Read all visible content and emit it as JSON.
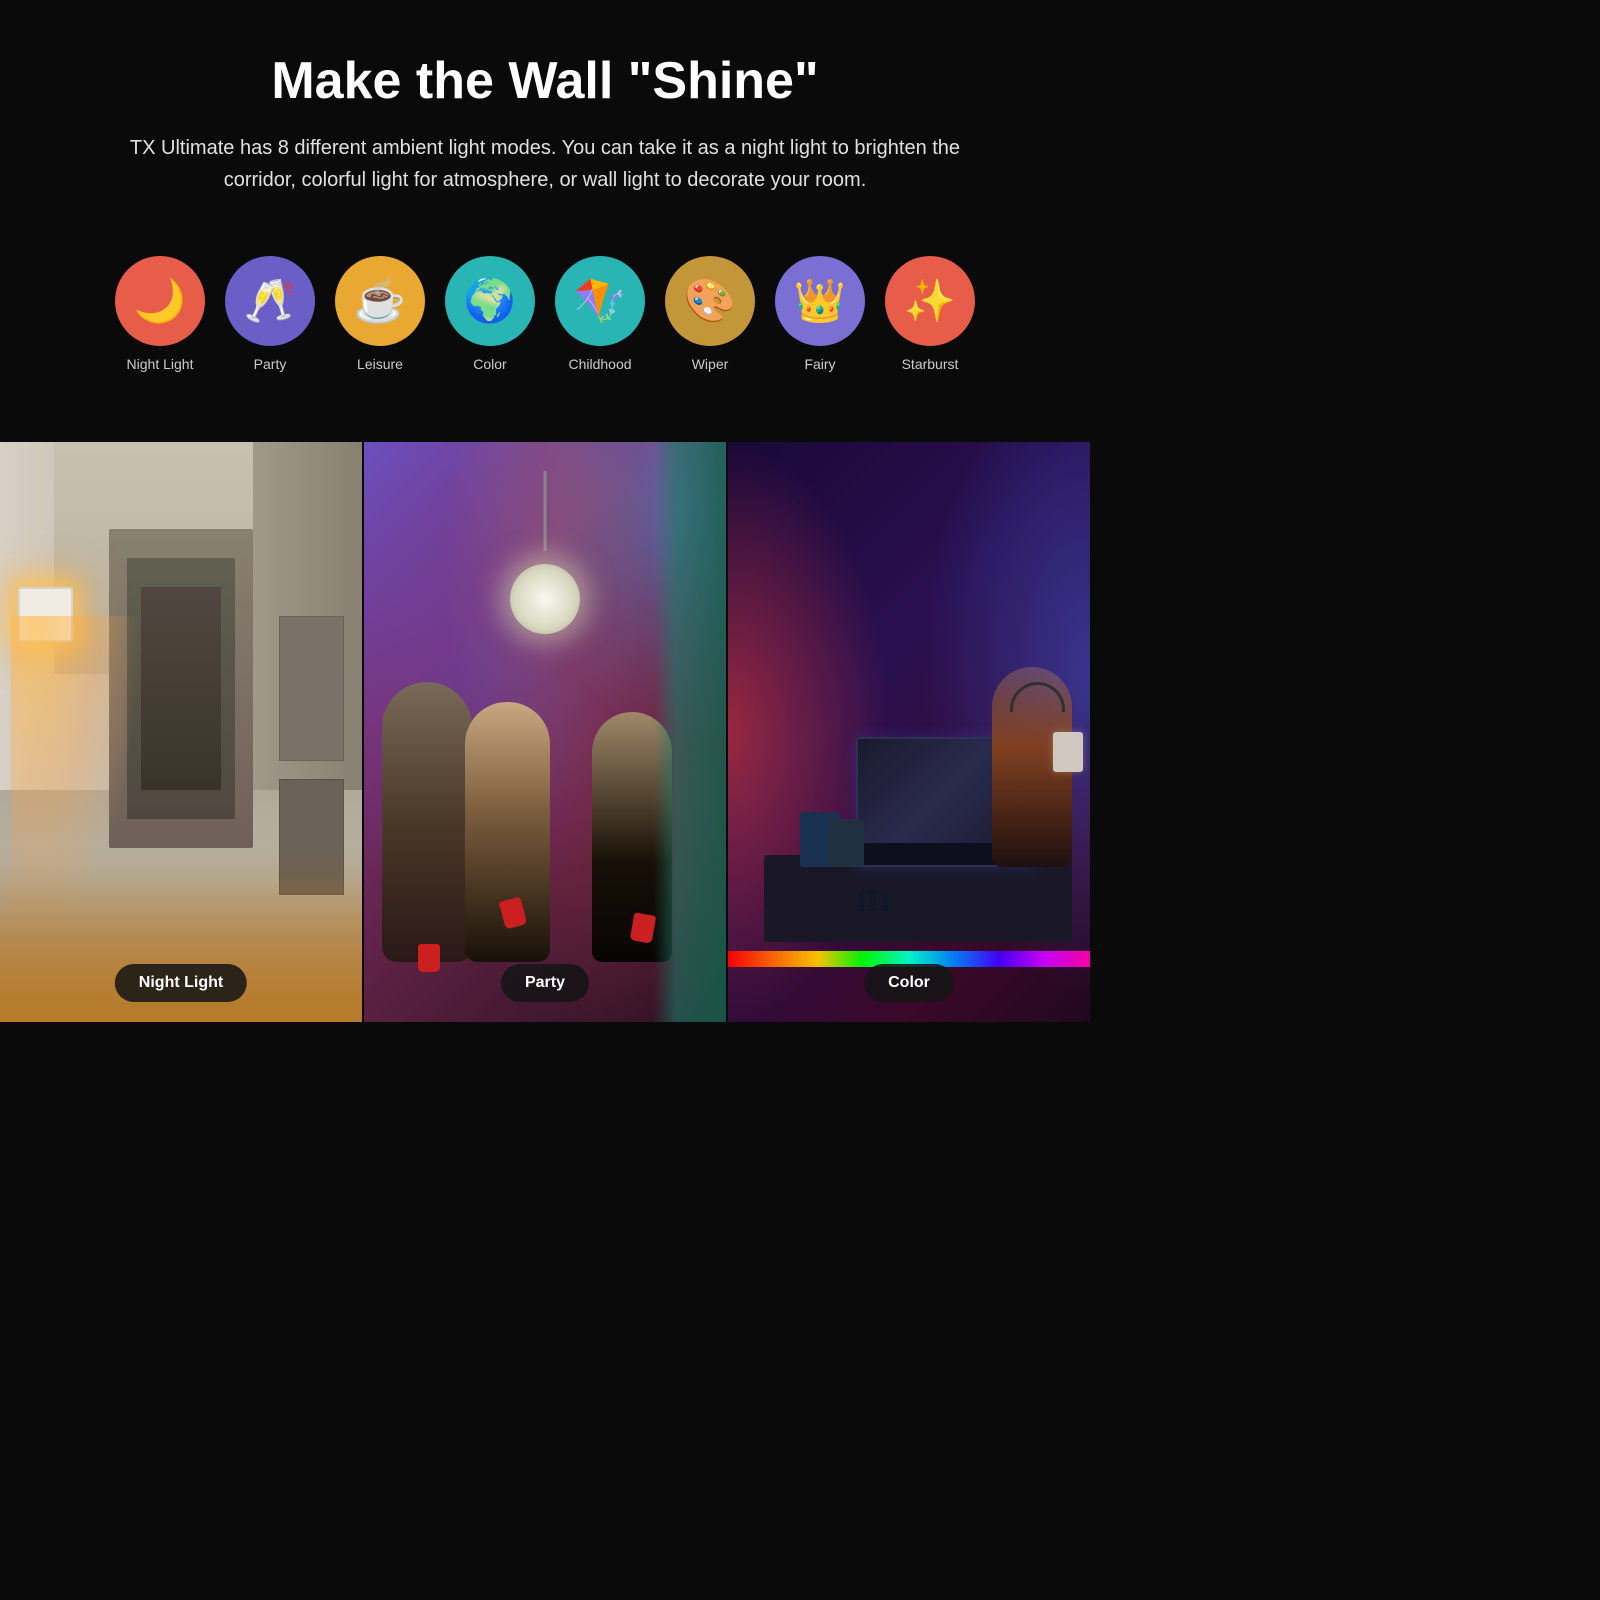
{
  "page": {
    "title": "Make the Wall \"Shine\"",
    "subtitle": "TX Ultimate has 8 different ambient light modes. You can take it as a night light to brighten the corridor, colorful light for atmosphere, or wall light to decorate your room.",
    "modes": [
      {
        "id": "night-light",
        "label": "Night Light",
        "icon": "🌙",
        "color_class": "icon-night-light",
        "emoji": "🌙"
      },
      {
        "id": "party",
        "label": "Party",
        "icon": "🥂",
        "color_class": "icon-party",
        "emoji": "🥂"
      },
      {
        "id": "leisure",
        "label": "Leisure",
        "icon": "☕",
        "color_class": "icon-leisure",
        "emoji": "☕"
      },
      {
        "id": "color",
        "label": "Color",
        "icon": "🌍",
        "color_class": "icon-color",
        "emoji": "🌍"
      },
      {
        "id": "childhood",
        "label": "Childhood",
        "icon": "🪁",
        "color_class": "icon-childhood",
        "emoji": "🪁"
      },
      {
        "id": "wiper",
        "label": "Wiper",
        "icon": "🎨",
        "color_class": "icon-wiper",
        "emoji": "🎨"
      },
      {
        "id": "fairy",
        "label": "Fairy",
        "icon": "👑",
        "color_class": "icon-fairy",
        "emoji": "👑"
      },
      {
        "id": "starburst",
        "label": "Starburst",
        "icon": "✨",
        "color_class": "icon-starburst",
        "emoji": "✨"
      }
    ],
    "panels": [
      {
        "id": "night-light-panel",
        "label": "Night Light"
      },
      {
        "id": "party-panel",
        "label": "Party"
      },
      {
        "id": "color-panel",
        "label": "Color"
      }
    ]
  }
}
